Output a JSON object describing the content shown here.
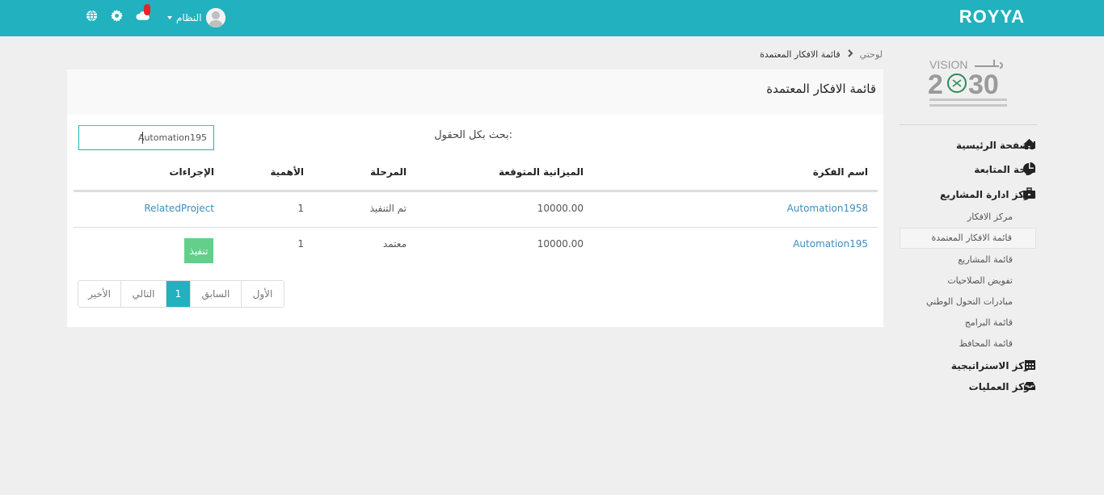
{
  "header": {
    "brand": "ROYYA",
    "user_name": "النظام"
  },
  "breadcrumb": {
    "home": "لوحتي",
    "current": "قائمة الافكار المعتمدة"
  },
  "sidebar": {
    "logo_text": "VISION 2030",
    "items": [
      {
        "label": "الصفحة الرئيسية",
        "icon": "home-icon"
      },
      {
        "label": "لوحة المتابعة",
        "icon": "pie-chart-icon"
      },
      {
        "label": "مركز ادارة المشاريع",
        "icon": "briefcase-icon"
      },
      {
        "label": "مركز الاستراتيجية",
        "icon": "calendar-icon"
      },
      {
        "label": "مركز العمليات",
        "icon": "inbox-icon"
      }
    ],
    "sub_items": [
      "مركز الافكار",
      "قائمة الافكار المعتمدة",
      "قائمة المشاريع",
      "تفويض الصلاحيات",
      "مبادرات التحول الوطني",
      "قائمة البرامج",
      "قائمة المحافظ"
    ]
  },
  "card": {
    "title": "قائمة الافكار المعتمدة",
    "search_label": "بحث بكل الحقول:",
    "search_value": "Automation195"
  },
  "table": {
    "headers": [
      "اسم الفكرة",
      "الميزانية المتوقعة",
      "المرحلة",
      "الأهمية",
      "الإجراءات"
    ],
    "rows": [
      {
        "name": "Automation1958",
        "budget": "10000.00",
        "stage": "تم التنفيذ",
        "importance": "1",
        "action": "RelatedProject"
      },
      {
        "name": "Automation195",
        "budget": "10000.00",
        "stage": "معتمد",
        "importance": "1",
        "action": "تنفيذ"
      }
    ]
  },
  "pagination": {
    "first": "الأول",
    "prev": "السابق",
    "current": "1",
    "next": "التالي",
    "last": "الأخير"
  },
  "colors": {
    "primary": "#22b1be",
    "success": "#63cf8a",
    "link": "#3c8dbc"
  }
}
